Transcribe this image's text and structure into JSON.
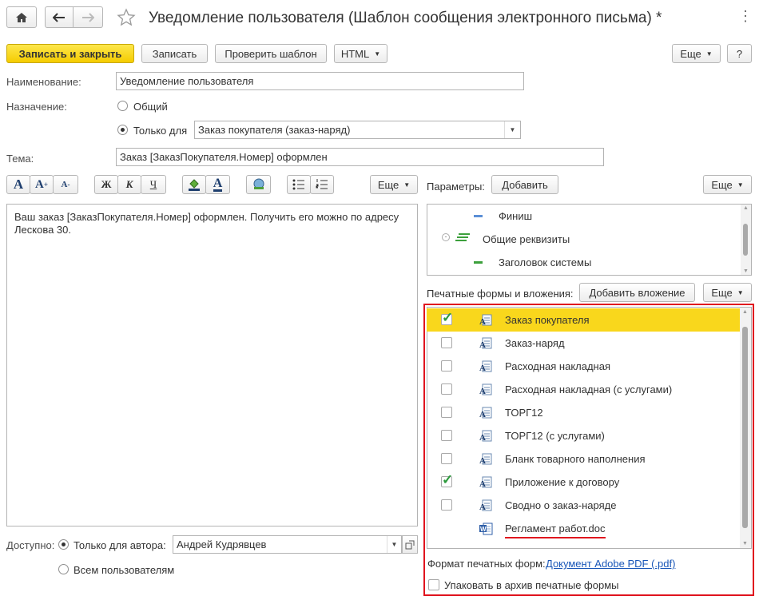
{
  "window": {
    "title": "Уведомление пользователя (Шаблон сообщения электронного письма) *"
  },
  "toolbar": {
    "save_close": "Записать и закрыть",
    "save": "Записать",
    "check_template": "Проверить шаблон",
    "format": "HTML",
    "more": "Еще",
    "help": "?"
  },
  "form": {
    "name_label": "Наименование:",
    "name_value": "Уведомление пользователя",
    "purpose_label": "Назначение:",
    "purpose_general": "Общий",
    "purpose_only_for": "Только для",
    "purpose_type_value": "Заказ покупателя (заказ-наряд)",
    "subject_label": "Тема:",
    "subject_value": "Заказ [ЗаказПокупателя.Номер] оформлен"
  },
  "editor": {
    "more": "Еще",
    "body_text": "Ваш заказ [ЗаказПокупателя.Номер] оформлен. Получить его можно по адресу Лескова 30.",
    "format_buttons": [
      "A",
      "A",
      "A",
      "Ж",
      "К",
      "Ч",
      "A"
    ]
  },
  "params": {
    "label": "Параметры:",
    "add": "Добавить",
    "more": "Еще",
    "tree": [
      "Финиш",
      "Общие реквизиты",
      "Заголовок системы"
    ]
  },
  "attachments": {
    "label": "Печатные формы и вложения:",
    "add": "Добавить вложение",
    "more": "Еще",
    "items": [
      {
        "label": "Заказ покупателя",
        "checked": true,
        "selected": true
      },
      {
        "label": "Заказ-наряд",
        "checked": false
      },
      {
        "label": "Расходная накладная",
        "checked": false
      },
      {
        "label": "Расходная накладная (с услугами)",
        "checked": false
      },
      {
        "label": "ТОРГ12",
        "checked": false
      },
      {
        "label": "ТОРГ12 (с услугами)",
        "checked": false
      },
      {
        "label": "Бланк товарного наполнения",
        "checked": false
      },
      {
        "label": "Приложение к договору",
        "checked": true
      },
      {
        "label": "Сводно о заказ-наряде",
        "checked": false
      },
      {
        "label": "Регламент работ.doc",
        "is_file": true
      }
    ],
    "format_label": "Формат печатных форм:",
    "format_link": "Документ Adobe PDF (.pdf)",
    "zip_label": "Упаковать в архив печатные формы"
  },
  "access": {
    "label": "Доступно:",
    "author_only": "Только для автора:",
    "author_value": "Андрей Кудрявцев",
    "all_users": "Всем пользователям"
  },
  "colors": {
    "accent_yellow": "#f9d71c",
    "highlight_red": "#e0141e",
    "link_blue": "#1a57b8",
    "check_green": "#2c9a3c"
  }
}
